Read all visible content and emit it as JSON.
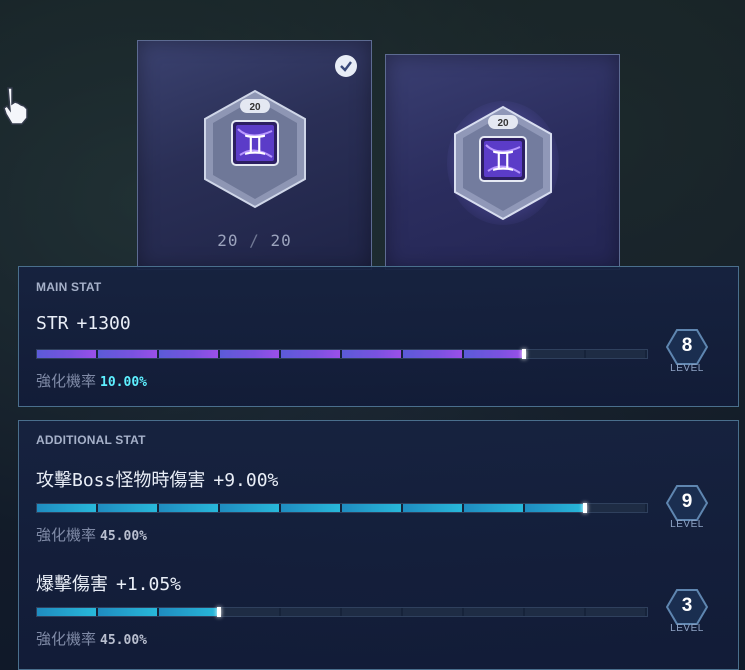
{
  "cards": {
    "left": {
      "count_current": "20",
      "count_sep": "/",
      "count_max": "20",
      "badge_level": "20",
      "zodiac_glyph": "♊",
      "selected": true
    },
    "right": {
      "badge_level": "20",
      "zodiac_glyph": "♊"
    }
  },
  "main_stat": {
    "label": "MAIN STAT",
    "stat_name": "STR",
    "stat_value": "+1300",
    "progress_fraction": 0.8,
    "rate_label": "強化機率",
    "rate_value": "10.00%",
    "level": "8",
    "level_label": "LEVEL"
  },
  "additional_stat": {
    "label": "ADDITIONAL STAT",
    "stats": [
      {
        "stat_name": "攻擊Boss怪物時傷害",
        "stat_value": "+9.00%",
        "progress_fraction": 0.9,
        "rate_label": "強化機率",
        "rate_value": "45.00%",
        "level": "9",
        "level_label": "LEVEL"
      },
      {
        "stat_name": "爆擊傷害",
        "stat_value": "+1.05%",
        "progress_fraction": 0.3,
        "rate_label": "強化機率",
        "rate_value": "45.00%",
        "level": "3",
        "level_label": "LEVEL"
      }
    ]
  },
  "colors": {
    "main_bar": "#7a52e0",
    "additional_bar": "#28b8da",
    "main_rate": "#5ef0ff",
    "additional_rate": "#b9bfcf"
  },
  "icons": [
    "pointer-hand-icon",
    "checkmark-icon",
    "gemini-emblem-icon",
    "level-hexagon-icon"
  ]
}
